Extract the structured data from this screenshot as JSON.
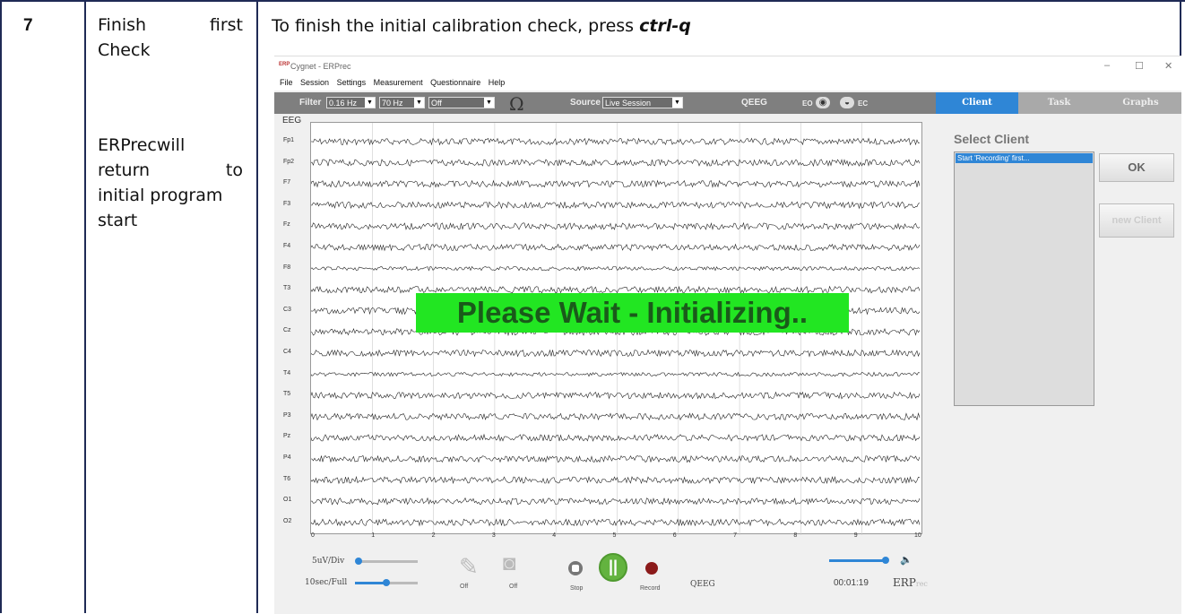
{
  "doc": {
    "step_number": "7",
    "task_title_word1": "Finish",
    "task_title_word2": "first",
    "task_title_line2": "Check",
    "desc_line1": "ERPrecwill",
    "desc_line2_a": "return",
    "desc_line2_b": "to",
    "desc_line3": "initial program",
    "desc_line4": "start",
    "instruction_text": "To finish the initial calibration check, press ",
    "instruction_key": "ctrl-q"
  },
  "app": {
    "window_title": "Cygnet - ERPrec",
    "logo_text": "ERP",
    "window_controls": {
      "minimize": "–",
      "maximize": "☐",
      "close": "✕"
    },
    "menu": [
      "File",
      "Session",
      "Settings",
      "Measurement",
      "Questionnaire",
      "Help"
    ],
    "toolbar": {
      "filter_label": "Filter",
      "filter_low": "0.16 Hz",
      "filter_high": "70 Hz",
      "notch": "Off",
      "source_label": "Source",
      "source_value": "Live Session",
      "mode_label": "QEEG",
      "eo_label": "EO",
      "ec_label": "EC"
    },
    "tabs": [
      "Client",
      "Task",
      "Graphs"
    ],
    "eeg_label": "EEG",
    "channels": [
      "Fp1",
      "Fp2",
      "F7",
      "F3",
      "Fz",
      "F4",
      "F8",
      "T3",
      "C3",
      "Cz",
      "C4",
      "T4",
      "T5",
      "P3",
      "Pz",
      "P4",
      "T6",
      "O1",
      "O2"
    ],
    "x_ticks": [
      "0",
      "1",
      "2",
      "3",
      "4",
      "5",
      "6",
      "7",
      "8",
      "9",
      "10"
    ],
    "overlay_message": "Please Wait - Initializing..",
    "client_panel": {
      "title": "Select Client",
      "list_item": "Start 'Recording' first...",
      "ok_button": "OK",
      "new_client_button": "new Client"
    },
    "bottom": {
      "scale_label": "5uV/Div",
      "time_label": "10sec/Full",
      "off_label_1": "Off",
      "off_label_2": "Off",
      "stop_label": "Stop",
      "record_label": "Record",
      "mode_label": "QEEG",
      "timer": "00:01:19",
      "brand_main": "ERP",
      "brand_sub": "rec"
    }
  }
}
